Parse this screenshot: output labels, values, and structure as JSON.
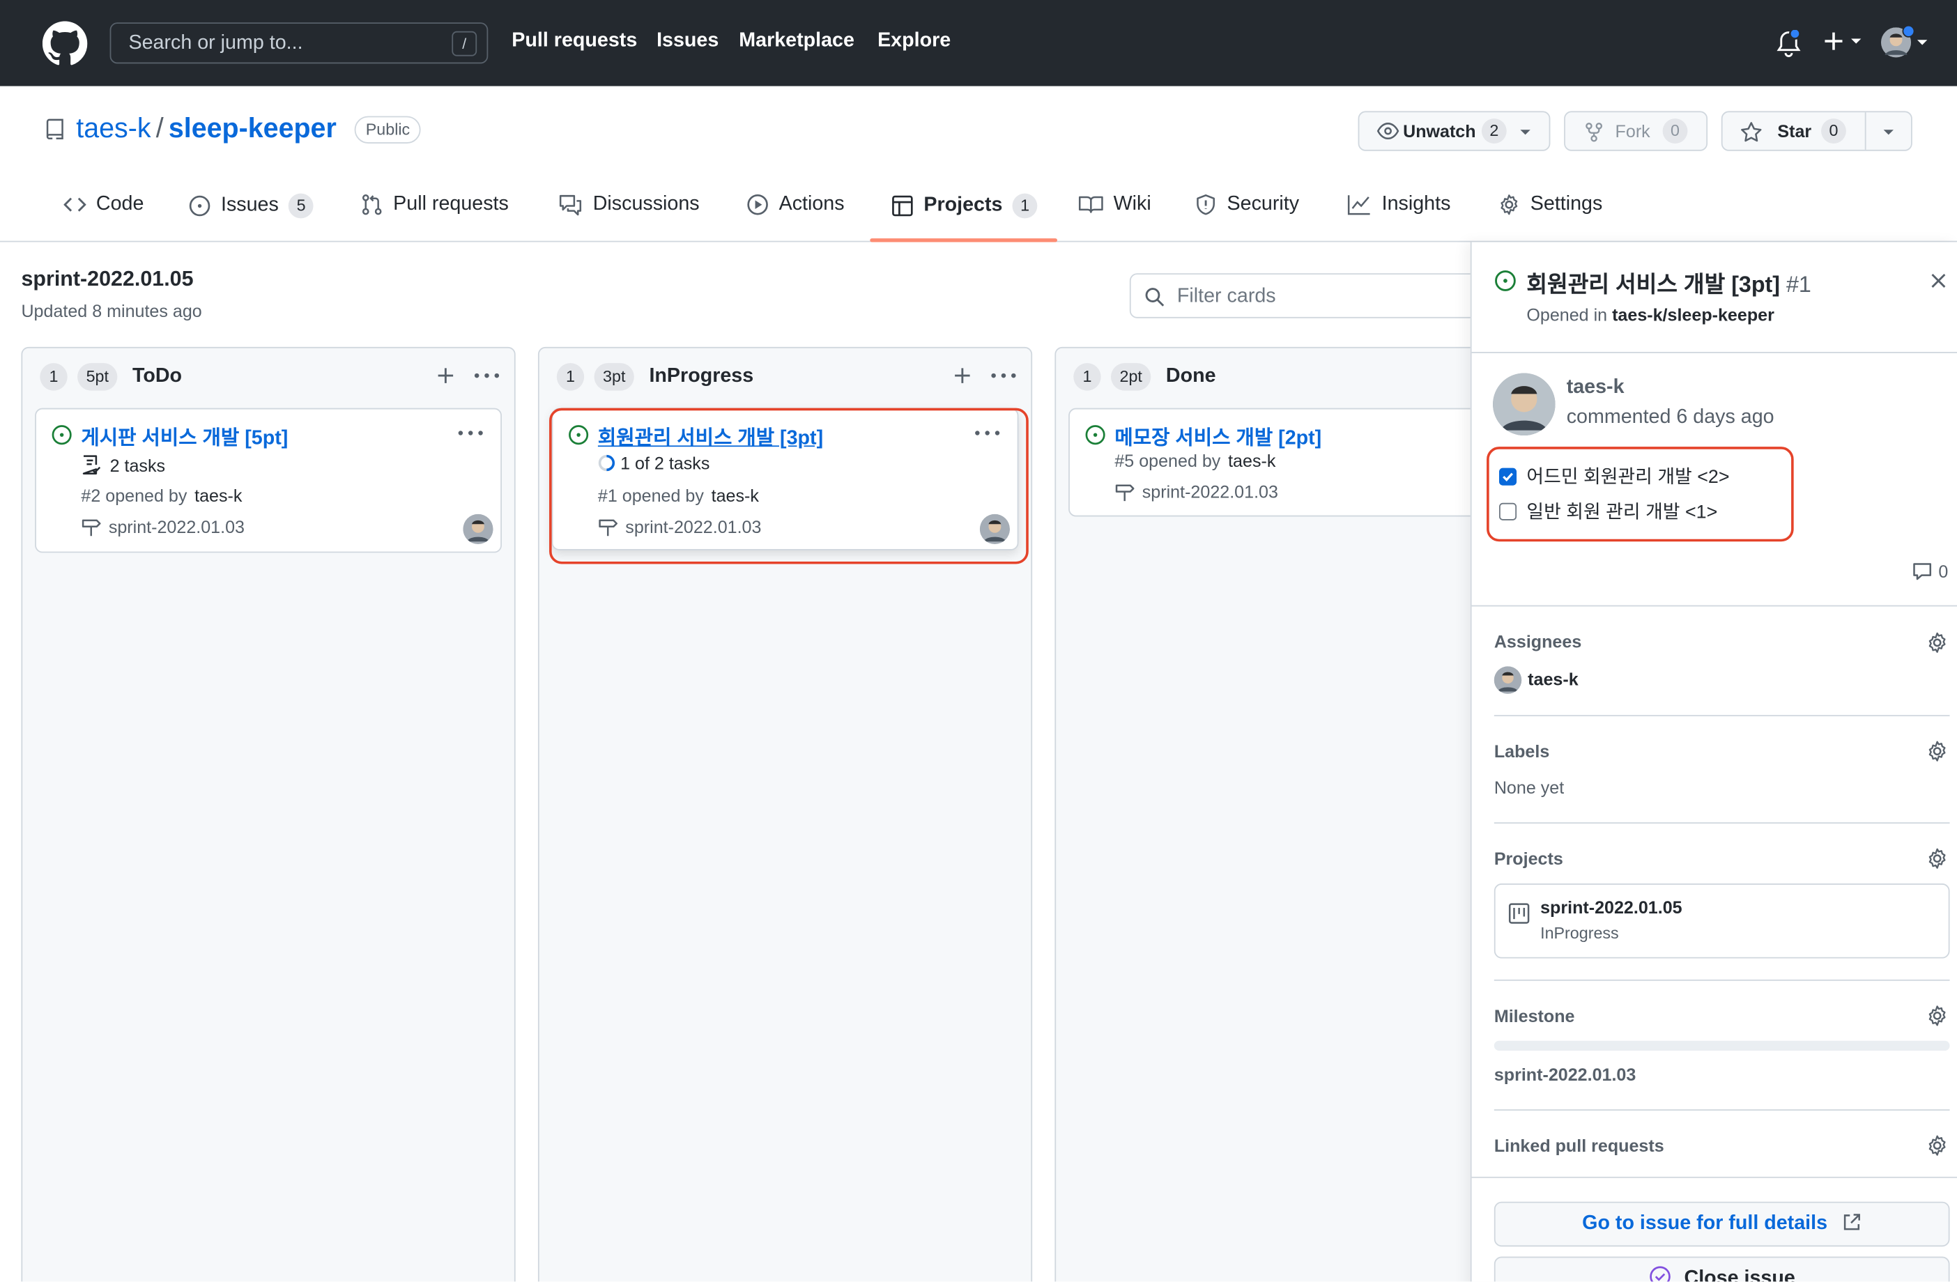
{
  "header": {
    "search_placeholder": "Search or jump to...",
    "search_shortcut": "/",
    "nav": [
      "Pull requests",
      "Issues",
      "Marketplace",
      "Explore"
    ],
    "plus_label": "+"
  },
  "repo": {
    "owner": "taes-k",
    "separator": "/",
    "name": "sleep-keeper",
    "visibility": "Public",
    "unwatch_label": "Unwatch",
    "unwatch_count": "2",
    "fork_label": "Fork",
    "fork_count": "0",
    "star_label": "Star",
    "star_count": "0"
  },
  "tabs": {
    "code": "Code",
    "issues": "Issues",
    "issues_count": "5",
    "pull_requests": "Pull requests",
    "discussions": "Discussions",
    "actions": "Actions",
    "projects": "Projects",
    "projects_count": "1",
    "wiki": "Wiki",
    "security": "Security",
    "insights": "Insights",
    "settings": "Settings"
  },
  "board": {
    "title": "sprint-2022.01.05",
    "updated": "Updated 8 minutes ago",
    "filter_placeholder": "Filter cards",
    "columns": [
      {
        "count": "1",
        "points": "5pt",
        "name": "ToDo",
        "card": {
          "title": "게시판 서비스 개발 [5pt]",
          "tasks": "2 tasks",
          "issue": "#2 opened by",
          "author": "taes-k",
          "milestone": "sprint-2022.01.03"
        }
      },
      {
        "count": "1",
        "points": "3pt",
        "name": "InProgress",
        "card": {
          "title": "회원관리 서비스 개발 [3pt]",
          "tasks": "1 of 2 tasks",
          "issue": "#1 opened by",
          "author": "taes-k",
          "milestone": "sprint-2022.01.03"
        }
      },
      {
        "count": "1",
        "points": "2pt",
        "name": "Done",
        "card": {
          "title": "메모장 서비스 개발 [2pt]",
          "issue": "#5 opened by",
          "author": "taes-k",
          "milestone": "sprint-2022.01.03"
        }
      }
    ]
  },
  "panel": {
    "title": "회원관리 서비스 개발 [3pt]",
    "number": "#1",
    "opened_in_prefix": "Opened in",
    "opened_in_repo": "taes-k/sleep-keeper",
    "comment_author": "taes-k",
    "comment_time": "commented 6 days ago",
    "tasks": [
      {
        "label": "어드민 회원관리 개발 <2>",
        "checked": true
      },
      {
        "label": "일반 회원 관리 개발 <1>",
        "checked": false
      }
    ],
    "comment_count": "0",
    "assignees_label": "Assignees",
    "assignee": "taes-k",
    "labels_label": "Labels",
    "labels_value": "None yet",
    "projects_label": "Projects",
    "project_name": "sprint-2022.01.05",
    "project_column": "InProgress",
    "milestone_label": "Milestone",
    "milestone_value": "sprint-2022.01.03",
    "linked_label": "Linked pull requests",
    "go_label": "Go to issue for full details",
    "close_label": "Close issue"
  },
  "colors": {
    "header_bg": "#24292f",
    "link": "#0969da",
    "open_issue": "#1a7f37",
    "highlight": "#e5432a",
    "tab_underline": "#fd8c73"
  },
  "icons": [
    "github-logo-icon",
    "bell-icon",
    "plus-icon",
    "eye-icon",
    "fork-icon",
    "star-icon",
    "code-icon",
    "issue-icon",
    "pull-request-icon",
    "discussions-icon",
    "actions-icon",
    "project-icon",
    "wiki-icon",
    "shield-icon",
    "graph-icon",
    "gear-icon",
    "search-icon",
    "kebab-icon",
    "checklist-icon",
    "milestone-icon",
    "close-icon",
    "comment-icon",
    "external-link-icon"
  ]
}
